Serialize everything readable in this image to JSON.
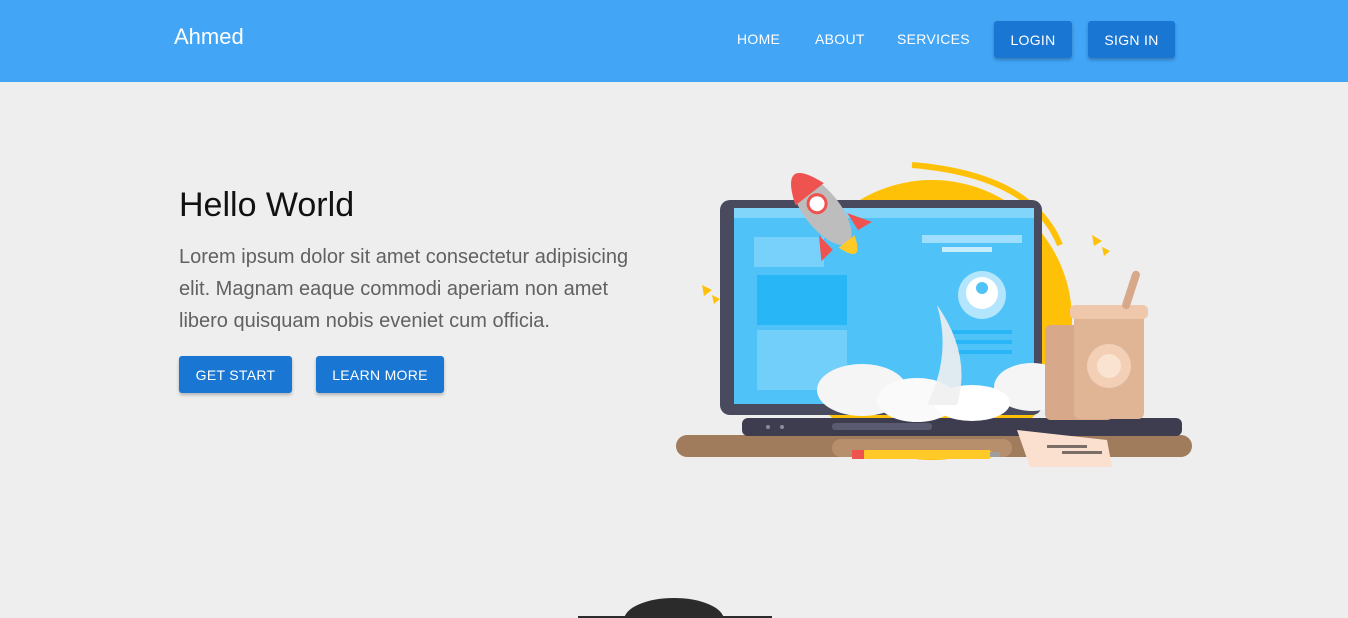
{
  "navbar": {
    "brand": "Ahmed",
    "links": [
      "HOME",
      "ABOUT",
      "SERVICES"
    ],
    "login_label": "LOGIN",
    "signin_label": "SIGN IN"
  },
  "hero": {
    "title": "Hello World",
    "text": "Lorem ipsum dolor sit amet consectetur adipisicing elit. Magnam eaque commodi aperiam non amet libero quisquam nobis eveniet cum officia.",
    "primary_button": "GET START",
    "secondary_button": "LEARN MORE"
  },
  "colors": {
    "navbar": "#42a5f5",
    "button": "#1976d2",
    "background": "#eeeeee"
  }
}
